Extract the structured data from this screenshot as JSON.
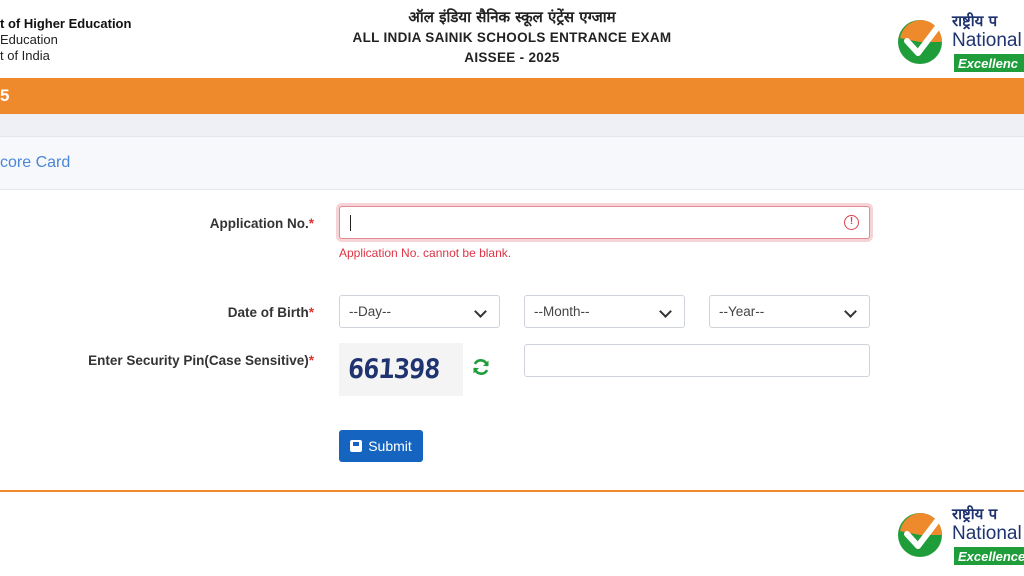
{
  "header": {
    "dept_line1": "t of Higher Education",
    "dept_line2": "Education",
    "dept_line3": "t of India",
    "title_hindi": "ऑल इंडिया सैनिक स्कूल एंट्रेंस एग्जाम",
    "title_english": "ALL INDIA SAINIK SCHOOLS ENTRANCE EXAM",
    "title_year": "AISSEE - 2025",
    "logo": {
      "hindi": "राष्ट्रीय प",
      "english": "National",
      "tagline": "Excellenc",
      "icon": "nta-check-logo-icon"
    }
  },
  "banner": {
    "text": "5"
  },
  "card": {
    "title": "core Card"
  },
  "form": {
    "application_no": {
      "label": "Application No.",
      "required_mark": "*",
      "value": "",
      "error": "Application No. cannot be blank.",
      "error_icon": "exclamation-circle-icon"
    },
    "dob": {
      "label": "Date of Birth",
      "required_mark": "*",
      "day": "--Day--",
      "month": "--Month--",
      "year": "--Year--"
    },
    "security_pin": {
      "label": "Enter Security Pin(Case Sensitive)",
      "required_mark": "*",
      "captcha": "661398",
      "refresh_icon": "refresh-icon",
      "value": ""
    },
    "submit": {
      "label": "Submit",
      "icon": "floppy-disk-icon"
    }
  },
  "footer": {
    "logo": {
      "hindi": "राष्ट्रीय प",
      "english": "National",
      "tagline": "Excellence"
    }
  },
  "colors": {
    "orange": "#ee8a2c",
    "submit_blue": "#1565c0",
    "card_title_blue": "#4a86d6",
    "error_red": "#dc3545",
    "logo_green": "#1f9d3a"
  }
}
